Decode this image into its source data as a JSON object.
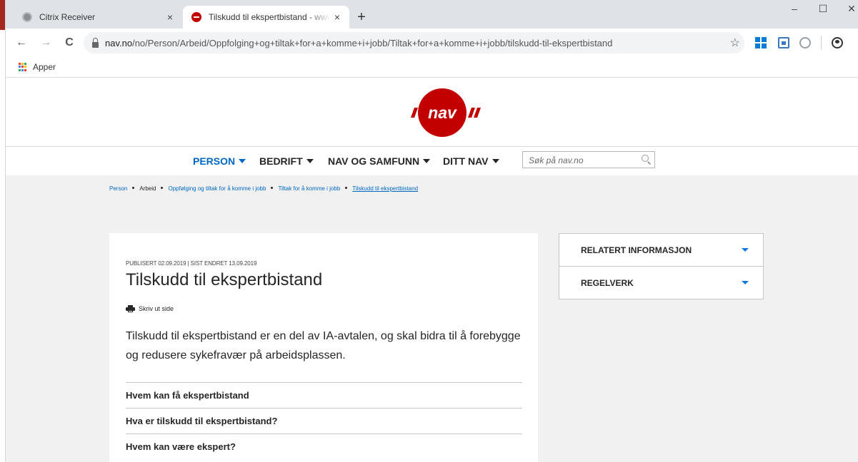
{
  "browser": {
    "tabs": [
      {
        "title": "Citrix Receiver",
        "active": false,
        "close": "×"
      },
      {
        "title": "Tilskudd til ekspertbistand - www.nav.no",
        "active": true,
        "close": "×"
      }
    ],
    "new_tab": "+",
    "window_controls": {
      "minimize": "–",
      "maximize": "☐",
      "close": "✕"
    },
    "nav": {
      "back": "←",
      "forward": "→",
      "reload": "C"
    },
    "url_host": "nav.no",
    "url_path": "/no/Person/Arbeid/Oppfolging+og+tiltak+for+a+komme+i+jobb/Tiltak+for+a+komme+i+jobb/tilskudd-til-ekspertbistand",
    "bookmark_star": "☆",
    "menu_dots": "⋮",
    "bookmarks_bar": {
      "label": "Apper",
      "icon_colors": [
        "#ea4335",
        "#fbbc05",
        "#34a853",
        "#4285f4",
        "#ea4335",
        "#fbbc05",
        "#34a853",
        "#4285f4",
        "#ea4335"
      ]
    }
  },
  "site": {
    "logo_text": "nav",
    "brand_color": "#c30000",
    "link_color": "#0067c5",
    "menu": [
      {
        "label": "PERSON",
        "active": true
      },
      {
        "label": "BEDRIFT",
        "active": false
      },
      {
        "label": "NAV OG SAMFUNN",
        "active": false
      },
      {
        "label": "DITT NAV",
        "active": false
      }
    ],
    "search": {
      "placeholder": "Søk på nav.no"
    },
    "breadcrumb": [
      {
        "label": "Person",
        "link": true
      },
      {
        "label": "Arbeid",
        "link": false
      },
      {
        "label": "Oppfølging og tiltak for å komme i jobb",
        "link": true
      },
      {
        "label": "Tiltak for å komme i jobb",
        "link": true
      },
      {
        "label": "Tilskudd til ekspertbistand",
        "link": true,
        "current": true
      }
    ],
    "article": {
      "meta": "PUBLISERT 02.09.2019 | SIST ENDRET 13.09.2019",
      "title": "Tilskudd til ekspertbistand",
      "print_label": "Skriv ut side",
      "ingress": "Tilskudd til ekspertbistand er en del av IA-avtalen, og skal bidra til å forebygge og redusere sykefravær på arbeidsplassen.",
      "sections": [
        "Hvem kan få ekspertbistand",
        "Hva er tilskudd til ekspertbistand?",
        "Hvem kan være ekspert?"
      ]
    },
    "sidebar": [
      {
        "label": "RELATERT INFORMASJON"
      },
      {
        "label": "REGELVERK"
      }
    ]
  }
}
